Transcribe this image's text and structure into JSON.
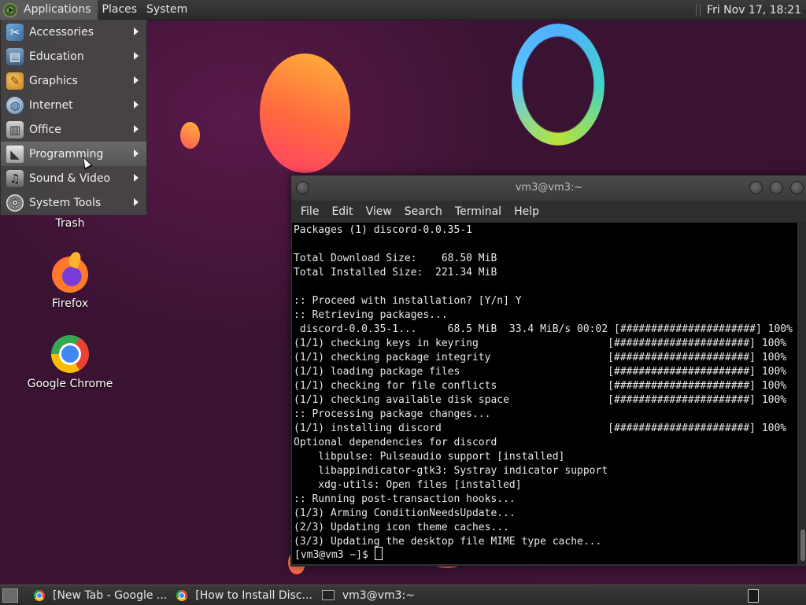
{
  "top_panel": {
    "applications_label": "Applications",
    "places_label": "Places",
    "system_label": "System",
    "clock": "Fri Nov 17, 18:21"
  },
  "app_menu": {
    "items": [
      {
        "label": "Accessories",
        "icon": "accessories-icon"
      },
      {
        "label": "Education",
        "icon": "education-icon"
      },
      {
        "label": "Graphics",
        "icon": "graphics-icon"
      },
      {
        "label": "Internet",
        "icon": "internet-icon"
      },
      {
        "label": "Office",
        "icon": "office-icon"
      },
      {
        "label": "Programming",
        "icon": "programming-icon"
      },
      {
        "label": "Sound & Video",
        "icon": "sound-video-icon"
      },
      {
        "label": "System Tools",
        "icon": "system-tools-icon"
      }
    ],
    "active_index": 5
  },
  "desktop_icons": {
    "trash": "Trash",
    "firefox": "Firefox",
    "chrome": "Google Chrome"
  },
  "terminal": {
    "title": "vm3@vm3:~",
    "menu": [
      "File",
      "Edit",
      "View",
      "Search",
      "Terminal",
      "Help"
    ],
    "lines": [
      "Packages (1) discord-0.0.35-1",
      "",
      "Total Download Size:    68.50 MiB",
      "Total Installed Size:  221.34 MiB",
      "",
      ":: Proceed with installation? [Y/n] Y",
      ":: Retrieving packages...",
      " discord-0.0.35-1...     68.5 MiB  33.4 MiB/s 00:02 [######################] 100%",
      "(1/1) checking keys in keyring                     [######################] 100%",
      "(1/1) checking package integrity                   [######################] 100%",
      "(1/1) loading package files                        [######################] 100%",
      "(1/1) checking for file conflicts                  [######################] 100%",
      "(1/1) checking available disk space                [######################] 100%",
      ":: Processing package changes...",
      "(1/1) installing discord                           [######################] 100%",
      "Optional dependencies for discord",
      "    libpulse: Pulseaudio support [installed]",
      "    libappindicator-gtk3: Systray indicator support",
      "    xdg-utils: Open files [installed]",
      ":: Running post-transaction hooks...",
      "(1/3) Arming ConditionNeedsUpdate...",
      "(2/3) Updating icon theme caches...",
      "(3/3) Updating the desktop file MIME type cache..."
    ],
    "prompt": "[vm3@vm3 ~]$ "
  },
  "taskbar": {
    "tasks": [
      {
        "label": "[New Tab - Google ...",
        "icon": "chrome-icon"
      },
      {
        "label": "[How to Install Disc...",
        "icon": "chrome-icon"
      },
      {
        "label": "vm3@vm3:~",
        "icon": "terminal-icon"
      }
    ]
  },
  "colors": {
    "desktop_bg": "#3a1232",
    "panel_bg": "#2e2e2e",
    "terminal_bg": "#000000",
    "menu_bg": "#464646"
  }
}
